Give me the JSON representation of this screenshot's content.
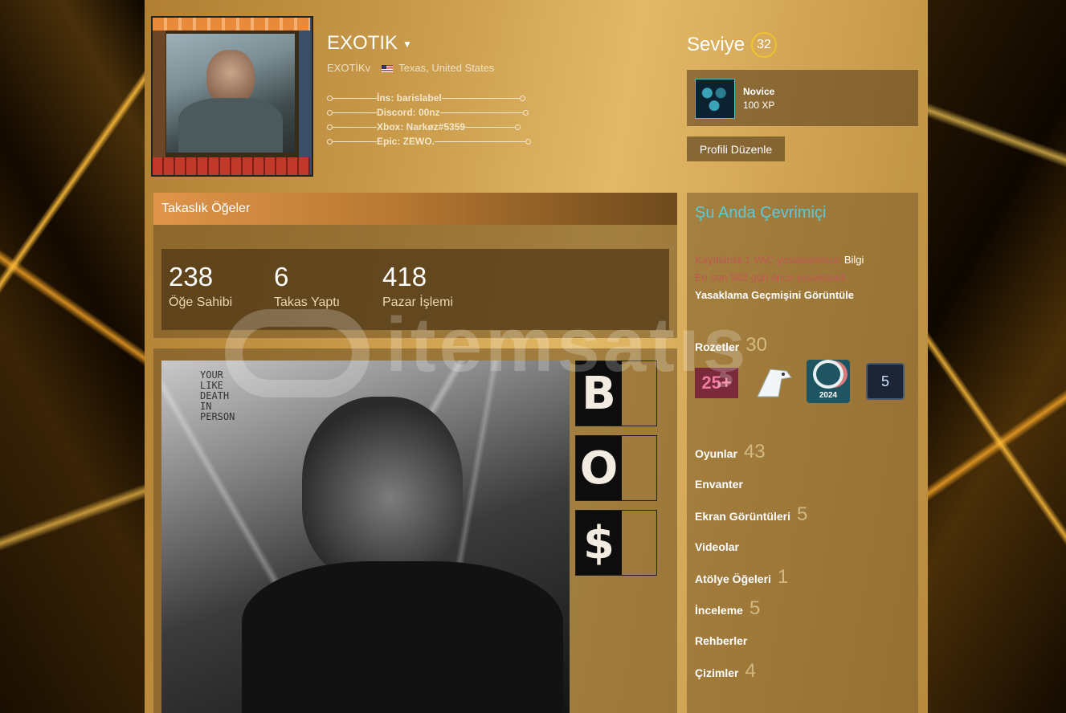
{
  "profile": {
    "persona_name": "EXOTIK",
    "real_name": "EXOTİKv",
    "location": "Texas, United States",
    "summary_lines": [
      "İns: barislabel",
      "Discord: 00nz",
      "Xbox: Narkøz#5359",
      "Epic: ZEWO."
    ]
  },
  "level": {
    "label": "Seviye",
    "value": "32",
    "badge_name": "Novice",
    "badge_xp": "100 XP",
    "edit_button": "Profili Düzenle"
  },
  "trade": {
    "header": "Takaslık Öğeler",
    "stats": [
      {
        "value": "238",
        "label": "Öğe Sahibi"
      },
      {
        "value": "6",
        "label": "Takas Yaptı"
      },
      {
        "value": "418",
        "label": "Pazar İşlemi"
      }
    ]
  },
  "showcase": {
    "photo_text": "YOUR\nLIKE\nDEATH\nIN\nPERSON",
    "letters": [
      "B",
      "O",
      "$"
    ]
  },
  "sidebar": {
    "status": "Şu Anda Çevrimiçi",
    "vac_text": "Kayıtlarda 1 VAC yasaklanması",
    "vac_info": "Bilgi",
    "vac_days": "En son 982 gün önce yasaklandı",
    "vac_history": "Yasaklama Geçmişini Görüntüle",
    "badges_label": "Rozetler",
    "badges_count": "30",
    "badge_tiles": [
      "25+",
      "",
      "2024",
      "5"
    ],
    "items": [
      {
        "label": "Oyunlar",
        "count": "43"
      },
      {
        "label": "Envanter",
        "count": ""
      },
      {
        "label": "Ekran Görüntüleri",
        "count": "5"
      },
      {
        "label": "Videolar",
        "count": ""
      },
      {
        "label": "Atölye Öğeleri",
        "count": "1"
      },
      {
        "label": "İnceleme",
        "count": "5"
      },
      {
        "label": "Rehberler",
        "count": ""
      },
      {
        "label": "Çizimler",
        "count": "4"
      }
    ]
  },
  "watermark": {
    "text": "itemsatış"
  },
  "colors": {
    "online": "#57cbde",
    "vac": "#c15755",
    "level_ring": "#f1c232"
  }
}
